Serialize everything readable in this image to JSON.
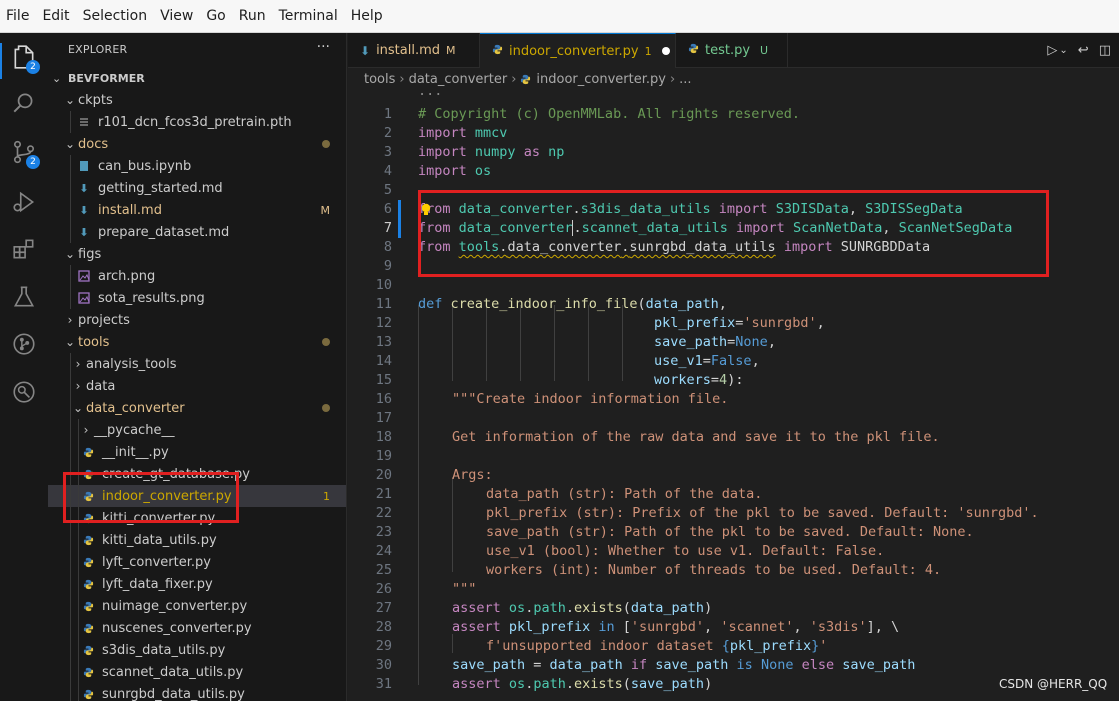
{
  "menubar": {
    "items": [
      "File",
      "Edit",
      "Selection",
      "View",
      "Go",
      "Run",
      "Terminal",
      "Help"
    ]
  },
  "activity_bar": {
    "explorer_badge": "2",
    "scm_badge": "2"
  },
  "sidebar": {
    "title": "EXPLORER",
    "more": "···",
    "project": "BEVFORMER",
    "tree": [
      {
        "label": "ckpts",
        "badge": ""
      },
      {
        "label": "r101_dcn_fcos3d_pretrain.pth",
        "badge": ""
      },
      {
        "label": "docs",
        "badge": ""
      },
      {
        "label": "can_bus.ipynb",
        "badge": ""
      },
      {
        "label": "getting_started.md",
        "badge": ""
      },
      {
        "label": "install.md",
        "badge": "M"
      },
      {
        "label": "prepare_dataset.md",
        "badge": ""
      },
      {
        "label": "figs",
        "badge": ""
      },
      {
        "label": "arch.png",
        "badge": ""
      },
      {
        "label": "sota_results.png",
        "badge": ""
      },
      {
        "label": "projects",
        "badge": ""
      },
      {
        "label": "tools",
        "badge": ""
      },
      {
        "label": "analysis_tools",
        "badge": ""
      },
      {
        "label": "data",
        "badge": ""
      },
      {
        "label": "data_converter",
        "badge": ""
      },
      {
        "label": "__pycache__",
        "badge": ""
      },
      {
        "label": "__init__.py",
        "badge": ""
      },
      {
        "label": "create_gt_database.py",
        "badge": ""
      },
      {
        "label": "indoor_converter.py",
        "badge": "1"
      },
      {
        "label": "kitti_converter.py",
        "badge": ""
      },
      {
        "label": "kitti_data_utils.py",
        "badge": ""
      },
      {
        "label": "lyft_converter.py",
        "badge": ""
      },
      {
        "label": "lyft_data_fixer.py",
        "badge": ""
      },
      {
        "label": "nuimage_converter.py",
        "badge": ""
      },
      {
        "label": "nuscenes_converter.py",
        "badge": ""
      },
      {
        "label": "s3dis_data_utils.py",
        "badge": ""
      },
      {
        "label": "scannet_data_utils.py",
        "badge": ""
      },
      {
        "label": "sunrgbd_data_utils.py",
        "badge": ""
      }
    ]
  },
  "tabs": [
    {
      "label": "install.md",
      "badge": "M"
    },
    {
      "label": "indoor_converter.py",
      "badge": "1"
    },
    {
      "label": "test.py",
      "badge": "U"
    }
  ],
  "breadcrumb": [
    "tools",
    "data_converter",
    "indoor_converter.py",
    "..."
  ],
  "editor": {
    "sticky": "...",
    "line_numbers": [
      "1",
      "2",
      "3",
      "4",
      "5",
      "6",
      "7",
      "8",
      "9",
      "10",
      "11",
      "12",
      "13",
      "14",
      "15",
      "16",
      "17",
      "18",
      "19",
      "20",
      "21",
      "22",
      "23",
      "24",
      "25",
      "26",
      "27",
      "28",
      "29",
      "30",
      "31"
    ],
    "lines": {
      "l1": "# Copyright (c) OpenMMLab. All rights reserved.",
      "l2a": "import",
      "l2b": "mmcv",
      "l3a": "import",
      "l3b": "numpy",
      "l3c": "as",
      "l3d": "np",
      "l4a": "import",
      "l4b": "os",
      "l6a": "from",
      "l6b": "data_converter",
      "l6c": ".",
      "l6d": "s3dis_data_utils",
      "l6e": "import",
      "l6f": "S3DISData",
      "l6g": ", ",
      "l6h": "S3DISSegData",
      "l7a": "from",
      "l7b": "data_converter",
      "l7c": ".",
      "l7d": "scannet_data_utils",
      "l7e": "import",
      "l7f": "ScanNetData",
      "l7g": ", ",
      "l7h": "ScanNetSegData",
      "l8a": "from",
      "l8b": "tools",
      "l8c": ".",
      "l8d": "data_converter",
      "l8e": ".",
      "l8f": "sunrgbd_data_utils",
      "l8g": "import",
      "l8h": "SUNRGBDData",
      "l11a": "def",
      "l11b": "create_indoor_info_file",
      "l11c": "(",
      "l11d": "data_path",
      "l11e": ",",
      "l12a": "pkl_prefix",
      "l12b": "=",
      "l12c": "'sunrgbd'",
      "l12d": ",",
      "l13a": "save_path",
      "l13b": "=",
      "l13c": "None",
      "l13d": ",",
      "l14a": "use_v1",
      "l14b": "=",
      "l14c": "False",
      "l14d": ",",
      "l15a": "workers",
      "l15b": "=",
      "l15c": "4",
      "l15d": "):",
      "l16": "\"\"\"Create indoor information file.",
      "l18": "Get information of the raw data and save it to the pkl file.",
      "l20": "Args:",
      "l21": "data_path (str): Path of the data.",
      "l22": "pkl_prefix (str): Prefix of the pkl to be saved. Default: 'sunrgbd'.",
      "l23": "save_path (str): Path of the pkl to be saved. Default: None.",
      "l24": "use_v1 (bool): Whether to use v1. Default: False.",
      "l25": "workers (int): Number of threads to be used. Default: 4.",
      "l26": "\"\"\"",
      "l27a": "assert",
      "l27b": "os",
      "l27c": ".",
      "l27d": "path",
      "l27e": ".",
      "l27f": "exists",
      "l27g": "(",
      "l27h": "data_path",
      "l27i": ")",
      "l28a": "assert",
      "l28b": "pkl_prefix",
      "l28c": "in",
      "l28d": "[",
      "l28e": "'sunrgbd'",
      "l28f": ", ",
      "l28g": "'scannet'",
      "l28h": ", ",
      "l28i": "'s3dis'",
      "l28j": "], \\",
      "l29a": "f'unsupported indoor dataset ",
      "l29b": "{",
      "l29c": "pkl_prefix",
      "l29d": "}",
      "l29e": "'",
      "l30a": "save_path",
      "l30b": " = ",
      "l30c": "data_path",
      "l30d": "if",
      "l30e": "save_path",
      "l30f": "is",
      "l30g": "None",
      "l30h": "else",
      "l30i": "save_path",
      "l31a": "assert",
      "l31b": "os",
      "l31c": ".",
      "l31d": "path",
      "l31e": ".",
      "l31f": "exists",
      "l31g": "(",
      "l31h": "save_path",
      "l31i": ")"
    }
  },
  "watermark": "CSDN @HERR_QQ",
  "colors": {
    "annotation": "#e02020",
    "accent": "#0078d4",
    "modified": "#e2c08d",
    "warning": "#cca700"
  }
}
